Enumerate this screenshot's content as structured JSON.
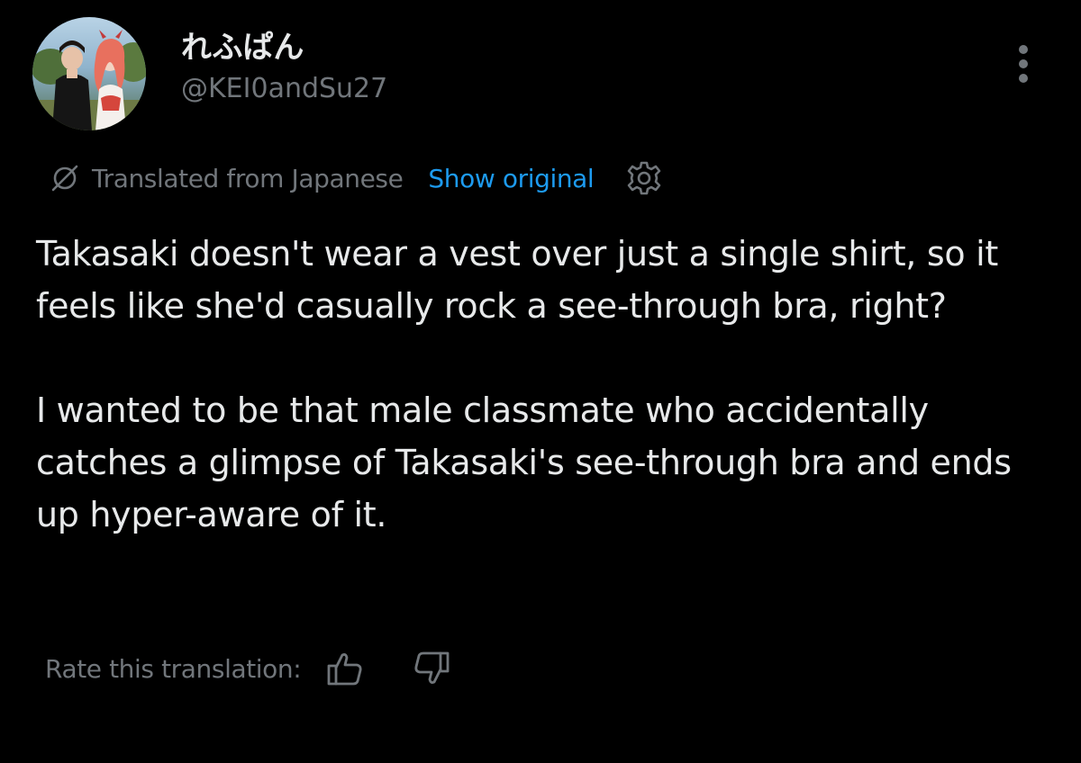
{
  "user": {
    "display_name": "れふぱん",
    "handle": "@KEI0andSu27",
    "avatar_icon": "profile-avatar-image"
  },
  "menu": {
    "more_icon": "more-vertical-icon"
  },
  "translation": {
    "icon": "translate-slash-icon",
    "label": "Translated from Japanese",
    "show_original_label": "Show original",
    "settings_icon": "gear-icon"
  },
  "tweet": {
    "paragraphs": [
      "Takasaki doesn't wear a vest over just a single shirt, so it feels like she'd casually rock a see-through bra, right?",
      "I wanted to be that male classmate who accidentally catches a glimpse of Takasaki's see-through bra and ends up hyper-aware of it."
    ]
  },
  "rating": {
    "label": "Rate this translation:",
    "thumbs_up_icon": "thumbs-up-icon",
    "thumbs_down_icon": "thumbs-down-icon"
  },
  "colors": {
    "background": "#000000",
    "primary_text": "#e7e9ea",
    "secondary_text": "#71767b",
    "link": "#1d9bf0"
  }
}
